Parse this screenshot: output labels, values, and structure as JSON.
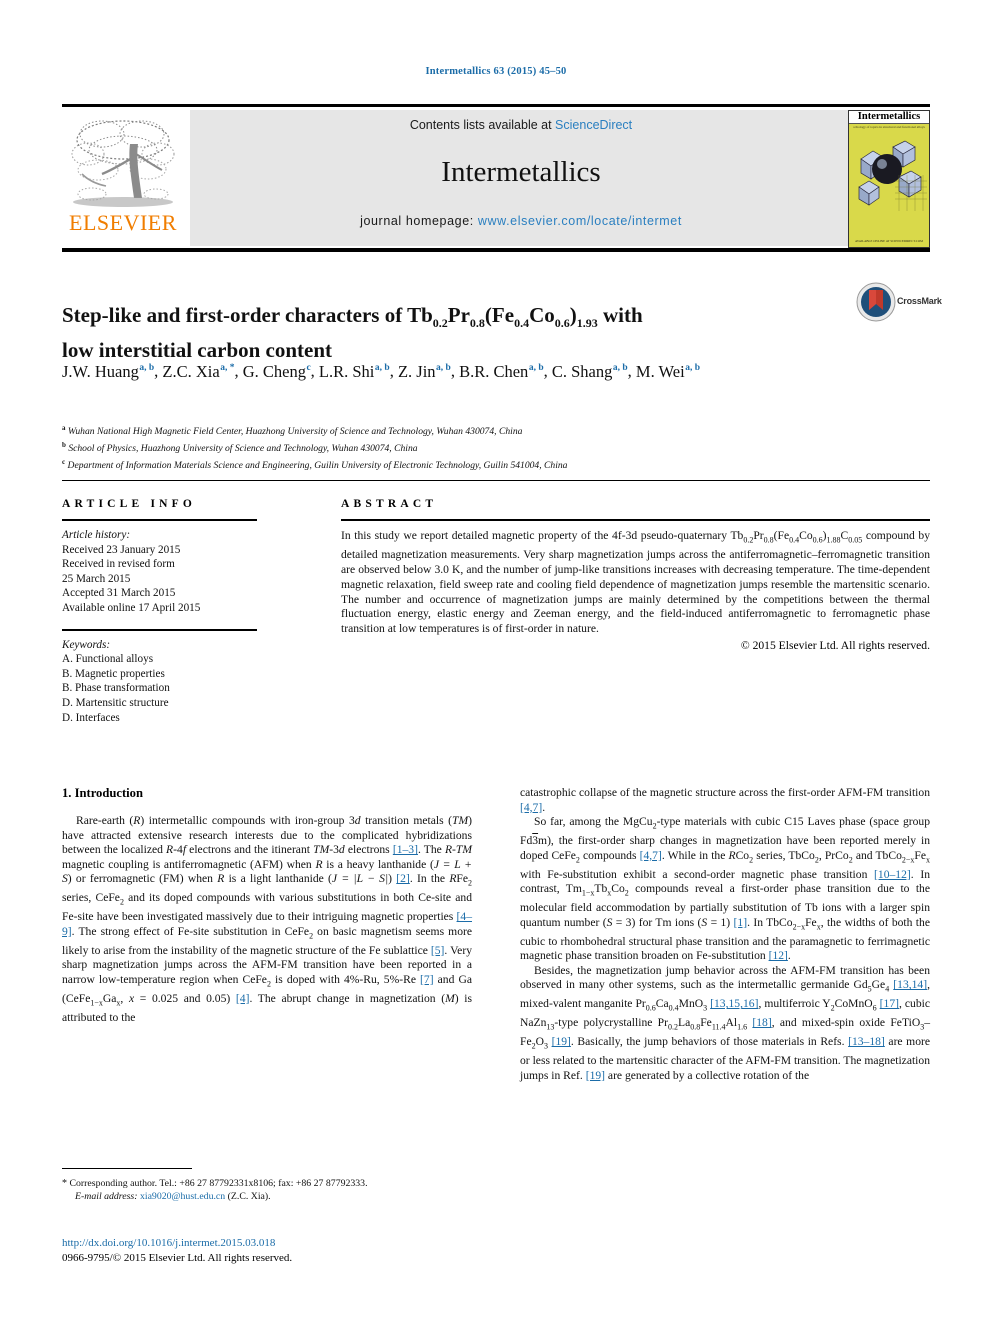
{
  "running_head": "Intermetallics 63 (2015) 45–50",
  "masthead": {
    "contents_prefix": "Contents lists available at ",
    "contents_link": "ScienceDirect",
    "journal_name": "Intermetallics",
    "homepage_prefix": "journal homepage: ",
    "homepage_link": "www.elsevier.com/locate/intermet",
    "publisher": "ELSEVIER",
    "cover_title": "Intermetallics",
    "cover_subtitle": "a thology of topics in structural and functional alloys",
    "cover_footer": "AVAILABLE ONLINE AT SCIENCEDIRECT.COM"
  },
  "article": {
    "title_line1_pre": "Step-like and first-order characters of Tb",
    "title_sub1": "0.2",
    "title_mid1": "Pr",
    "title_sub2": "0.8",
    "title_mid2": "(Fe",
    "title_sub3": "0.4",
    "title_mid3": "Co",
    "title_sub4": "0.6",
    "title_mid4": ")",
    "title_sub5": "1.93",
    "title_end1": " with",
    "title_line2": "low interstitial carbon content",
    "crossmark_label": "CrossMark",
    "authors": [
      {
        "name": "J.W. Huang",
        "marks": "a, b"
      },
      {
        "name": "Z.C. Xia",
        "marks": "a, *"
      },
      {
        "name": "G. Cheng",
        "marks": "c"
      },
      {
        "name": "L.R. Shi",
        "marks": "a, b"
      },
      {
        "name": "Z. Jin",
        "marks": "a, b"
      },
      {
        "name": "B.R. Chen",
        "marks": "a, b"
      },
      {
        "name": "C. Shang",
        "marks": "a, b"
      },
      {
        "name": "M. Wei",
        "marks": "a, b"
      }
    ],
    "affiliations": [
      {
        "mark": "a",
        "text": "Wuhan National High Magnetic Field Center, Huazhong University of Science and Technology, Wuhan 430074, China"
      },
      {
        "mark": "b",
        "text": "School of Physics, Huazhong University of Science and Technology, Wuhan 430074, China"
      },
      {
        "mark": "c",
        "text": "Department of Information Materials Science and Engineering, Guilin University of Electronic Technology, Guilin 541004, China"
      }
    ]
  },
  "article_info": {
    "heading": "ARTICLE INFO",
    "history_label": "Article history:",
    "history": [
      "Received 23 January 2015",
      "Received in revised form",
      "25 March 2015",
      "Accepted 31 March 2015",
      "Available online 17 April 2015"
    ],
    "keywords_label": "Keywords:",
    "keywords": [
      "A. Functional alloys",
      "B. Magnetic properties",
      "B. Phase transformation",
      "D. Martensitic structure",
      "D. Interfaces"
    ]
  },
  "abstract": {
    "heading": "ABSTRACT",
    "part1": "In this study we report detailed magnetic property of the 4f-3d pseudo-quaternary Tb",
    "s1": "0.2",
    "part2": "Pr",
    "s2": "0.8",
    "part3": "(Fe",
    "s3": "0.4",
    "part4": "Co",
    "s4": "0.6",
    "part5": ")",
    "s5": "1.88",
    "part6": "C",
    "s6": "0.05",
    "part7": " compound by detailed magnetization measurements. Very sharp magnetization jumps across the antiferromagnetic–ferromagnetic transition are observed below 3.0 K, and the number of jump-like transitions increases with decreasing temperature. The time-dependent magnetic relaxation, field sweep rate and cooling field dependence of magnetization jumps resemble the martensitic scenario. The number and occurrence of magnetization jumps are mainly determined by the competitions between the thermal fluctuation energy, elastic energy and Zeeman energy, and the field-induced antiferromagnetic to ferromagnetic phase transition at low temperatures is of first-order in nature.",
    "rights": "© 2015 Elsevier Ltd. All rights reserved."
  },
  "body": {
    "section_number_title": "1. Introduction",
    "left_para1_a": "Rare-earth (",
    "left_para1_b": "R",
    "left_para1_c": ") intermetallic compounds with iron-group 3",
    "left_para1_d": "d",
    "left_para1_e": " transition metals (",
    "left_para1_f": "TM",
    "left_para1_g": ") have attracted extensive research interests due to the complicated hybridizations between the localized ",
    "left_para1_h": "R",
    "left_para1_i": "-4",
    "left_para1_j": "f",
    "left_para1_k": " electrons and the itinerant ",
    "left_para1_l": "TM",
    "left_para1_m": "-3",
    "left_para1_n": "d",
    "left_para1_o": " electrons ",
    "left_ref1": "[1–3]",
    "left_para1_p": ". The ",
    "left_para1_q": "R-TM",
    "left_para1_r": " magnetic coupling is antiferromagnetic (AFM) when ",
    "left_para1_s": "R",
    "left_para1_t": " is a heavy lanthanide (",
    "left_para1_u": "J = L + S",
    "left_para1_v": ") or ferromagnetic (FM) when ",
    "left_para1_w": "R",
    "left_para1_x": " is a light lanthanide (",
    "left_para1_y": "J = |L − S|",
    "left_para1_z": ") ",
    "left_ref2": "[2]",
    "left_para1_aa": ". In the ",
    "left_para1_ab": "R",
    "left_para1_ac": "Fe",
    "left_para1_ac_sub": "2",
    "left_para1_ad": " series, CeFe",
    "left_para1_ad_sub": "2",
    "left_para1_ae": " and its doped compounds with various substitutions in both Ce-site and Fe-site have been investigated massively due to their intriguing magnetic properties ",
    "left_ref3": "[4–9]",
    "left_para1_af": ". The strong effect of Fe-site substitution in CeFe",
    "left_para1_af_sub": "2",
    "left_para1_ag": " on basic magnetism seems more likely to arise from the instability of the magnetic structure of the Fe sublattice ",
    "left_ref4": "[5]",
    "left_para1_ah": ". Very sharp magnetization jumps across the AFM-FM transition have been reported in a narrow low-temperature region when CeFe",
    "left_para1_ah_sub": "2",
    "left_para1_ai": " is doped with 4%-Ru, 5%-Re ",
    "left_ref5": "[7]",
    "left_para1_aj": " and Ga (CeFe",
    "left_para1_aj_sub": "1−x",
    "left_para1_ak": "Ga",
    "left_para1_ak_sub": "x",
    "left_para1_al": ", ",
    "left_para1_am": "x",
    "left_para1_an": " = 0.025 and 0.05) ",
    "left_ref6": "[4]",
    "left_para1_ao": ". The abrupt change in magnetization (",
    "left_para1_ap": "M",
    "left_para1_aq": ") is attributed to the",
    "right_para1_a": "catastrophic collapse of the magnetic structure across the first-order AFM-FM transition ",
    "right_ref1": "[4,7]",
    "right_para1_b": ".",
    "right_para2_a": "So far, among the MgCu",
    "right_para2_a_sub": "2",
    "right_para2_b": "-type materials with cubic C15 Laves phase (space group Fd",
    "right_para2_ovl": "3",
    "right_para2_c": "m), the first-order sharp changes in magnetization have been reported merely in doped CeFe",
    "right_para2_c_sub": "2",
    "right_para2_d": " compounds ",
    "right_ref2": "[4,7]",
    "right_para2_e": ". While in the ",
    "right_para2_f": "R",
    "right_para2_g": "Co",
    "right_para2_g_sub": "2",
    "right_para2_h": " series, TbCo",
    "right_para2_h_sub": "2",
    "right_para2_i": ", PrCo",
    "right_para2_i_sub": "2",
    "right_para2_j": " and TbCo",
    "right_para2_j_sub": "2−x",
    "right_para2_k": "Fe",
    "right_para2_k_sub": "x",
    "right_para2_l": " with Fe-substitution exhibit a second-order magnetic phase transition ",
    "right_ref3": "[10–12]",
    "right_para2_m": ". In contrast, Tm",
    "right_para2_m_sub": "1−x",
    "right_para2_n": "Tb",
    "right_para2_n_sub": "x",
    "right_para2_o": "Co",
    "right_para2_o_sub": "2",
    "right_para2_p": " compounds reveal a first-order phase transition due to the molecular field accommodation by partially substitution of Tb ions with a larger spin quantum number (",
    "right_para2_q": "S",
    "right_para2_r": " = 3) for Tm ions (",
    "right_para2_s": "S",
    "right_para2_t": " = 1) ",
    "right_ref4": "[1]",
    "right_para2_u": ". In TbCo",
    "right_para2_u_sub": "2−x",
    "right_para2_v": "Fe",
    "right_para2_v_sub": "x",
    "right_para2_w": ", the widths of both the cubic to rhombohedral structural phase transition and the paramagnetic to ferrimagnetic magnetic phase transition broaden on Fe-substitution ",
    "right_ref5": "[12]",
    "right_para2_x": ".",
    "right_para3_a": "Besides, the magnetization jump behavior across the AFM-FM transition has been observed in many other systems, such as the intermetallic germanide Gd",
    "right_para3_a_sub": "5",
    "right_para3_b": "Ge",
    "right_para3_b_sub": "4",
    "right_para3_c": " ",
    "right_ref6": "[13,14]",
    "right_para3_d": ", mixed-valent manganite Pr",
    "right_para3_d_sub": "0.6",
    "right_para3_e": "Ca",
    "right_para3_e_sub": "0.4",
    "right_para3_f": "MnO",
    "right_para3_f_sub": "3",
    "right_para3_g": " ",
    "right_ref7": "[13,15,16]",
    "right_para3_h": ", multiferroic Y",
    "right_para3_h_sub": "2",
    "right_para3_i": "CoMnO",
    "right_para3_i_sub": "6",
    "right_para3_j": " ",
    "right_ref8": "[17]",
    "right_para3_k": ", cubic NaZn",
    "right_para3_k_sub": "13",
    "right_para3_l": "-type polycrystalline Pr",
    "right_para3_l_sub": "0.2",
    "right_para3_m": "La",
    "right_para3_m_sub": "0.8",
    "right_para3_n": "Fe",
    "right_para3_n_sub": "11.4",
    "right_para3_o": "Al",
    "right_para3_o_sub": "1.6",
    "right_para3_p": " ",
    "right_ref9": "[18]",
    "right_para3_q": ", and mixed-spin oxide FeTiO",
    "right_para3_q_sub": "3",
    "right_para3_r": "–Fe",
    "right_para3_r_sub": "2",
    "right_para3_s": "O",
    "right_para3_s_sub": "3",
    "right_para3_t": " ",
    "right_ref10": "[19]",
    "right_para3_u": ". Basically, the jump behaviors of those materials in Refs. ",
    "right_ref11": "[13–18]",
    "right_para3_v": " are more or less related to the martensitic character of the AFM-FM transition. The magnetization jumps in Ref. ",
    "right_ref12": "[19]",
    "right_para3_w": " are generated by a collective rotation of the"
  },
  "footnote": {
    "star": "*",
    "corresponding": " Corresponding author. Tel.: +86 27 87792331x8106; fax: +86 27 87792333.",
    "email_label": "E-mail address:",
    "email": "xia9020@hust.edu.cn",
    "email_owner": " (Z.C. Xia)."
  },
  "publication": {
    "doi": "http://dx.doi.org/10.1016/j.intermet.2015.03.018",
    "issn_rights": "0966-9795/© 2015 Elsevier Ltd. All rights reserved."
  },
  "colors": {
    "link": "#1b6ca8",
    "elsevier_orange": "#f07d00",
    "cover_yellow": "#d9d94a",
    "masthead_grey": "#e6e6e6"
  }
}
